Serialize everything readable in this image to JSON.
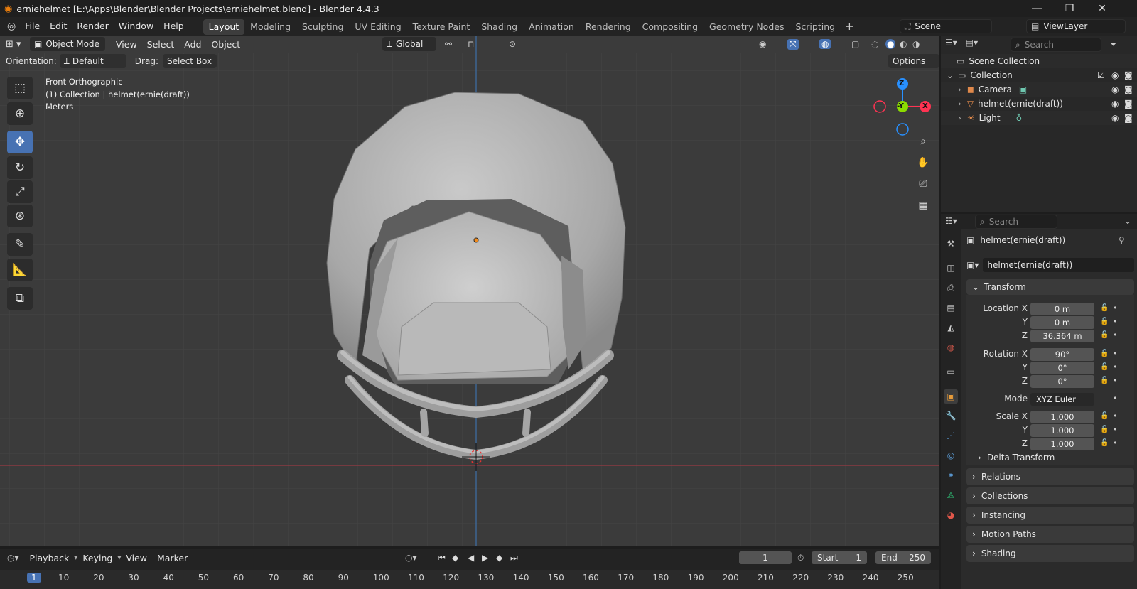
{
  "window": {
    "title": "erniehelmet [E:\\Apps\\Blender\\Blender Projects\\erniehelmet.blend] - Blender 4.4.3"
  },
  "menus": [
    "File",
    "Edit",
    "Render",
    "Window",
    "Help"
  ],
  "workspaces": [
    "Layout",
    "Modeling",
    "Sculpting",
    "UV Editing",
    "Texture Paint",
    "Shading",
    "Animation",
    "Rendering",
    "Compositing",
    "Geometry Nodes",
    "Scripting"
  ],
  "active_workspace": "Layout",
  "scene": {
    "name": "Scene",
    "view_layer": "ViewLayer"
  },
  "viewport": {
    "mode": "Object Mode",
    "menus": [
      "View",
      "Select",
      "Add",
      "Object"
    ],
    "transform_orientation": "Global",
    "orientation_label": "Orientation:",
    "orientation_value": "Default",
    "drag_label": "Drag:",
    "drag_value": "Select Box",
    "options": "Options",
    "overlay_line1": "Front Orthographic",
    "overlay_line2": "(1) Collection | helmet(ernie(draft))",
    "overlay_line3": "Meters",
    "gizmo": {
      "z": "Z",
      "y": "-Y",
      "x": "X"
    }
  },
  "outliner": {
    "search_placeholder": "Search",
    "root": "Scene Collection",
    "collection": "Collection",
    "items": [
      "Camera",
      "helmet(ernie(draft))",
      "Light"
    ]
  },
  "properties": {
    "search_placeholder": "Search",
    "object_name": "helmet(ernie(draft))",
    "data_name": "helmet(ernie(draft))",
    "transform_header": "Transform",
    "location": {
      "label": "Location X",
      "x": "0 m",
      "y": "0 m",
      "z": "36.364 m"
    },
    "rotation": {
      "label": "Rotation X",
      "x": "90°",
      "y": "0°",
      "z": "0°"
    },
    "mode_label": "Mode",
    "mode_value": "XYZ Euler",
    "scale": {
      "label": "Scale X",
      "x": "1.000",
      "y": "1.000",
      "z": "1.000"
    },
    "axis_y": "Y",
    "axis_z": "Z",
    "delta": "Delta Transform",
    "panels": [
      "Relations",
      "Collections",
      "Instancing",
      "Motion Paths",
      "Shading"
    ]
  },
  "timeline": {
    "menus": [
      "Playback",
      "Keying",
      "View",
      "Marker"
    ],
    "current_frame": "1",
    "start_label": "Start",
    "start": "1",
    "end_label": "End",
    "end": "250",
    "ruler": [
      "1",
      "10",
      "20",
      "30",
      "40",
      "50",
      "60",
      "70",
      "80",
      "90",
      "100",
      "110",
      "120",
      "130",
      "140",
      "150",
      "160",
      "170",
      "180",
      "190",
      "200",
      "210",
      "220",
      "230",
      "240",
      "250"
    ]
  },
  "colors": {
    "accent": "#4772b3",
    "x_axis": "#ff3352",
    "y_axis": "#8bdc00",
    "z_axis": "#2890ff",
    "frame": "#4772b3"
  }
}
